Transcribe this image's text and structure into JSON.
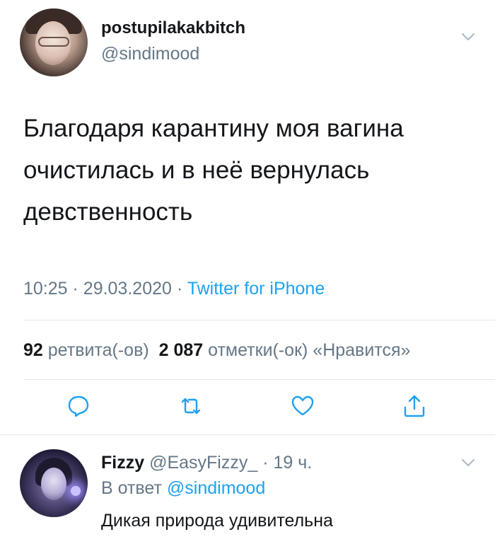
{
  "tweet": {
    "author_name": "postupilakakbitch",
    "author_handle": "@sindimood",
    "text": "Благодаря карантину моя вагина очистилась и в неё вернулась девственность",
    "time": "10:25",
    "date": "29.03.2020",
    "source": "Twitter for iPhone",
    "separator": "·",
    "retweets_count": "92",
    "retweets_label": "ретвита(-ов)",
    "likes_count": "2 087",
    "likes_label": "отметки(-ок) «Нравится»"
  },
  "actions": {
    "reply_icon": "reply-icon",
    "retweet_icon": "retweet-icon",
    "like_icon": "heart-icon",
    "share_icon": "share-icon"
  },
  "reply": {
    "author_name": "Fizzy",
    "author_handle": "@EasyFizzy_",
    "separator": "·",
    "time_ago": "19 ч.",
    "reply_to_label": "В ответ",
    "reply_to_handle": "@sindimood",
    "text": "Дикая природа удивительна"
  },
  "colors": {
    "text": "#14171a",
    "secondary": "#657786",
    "accent": "#1da1f2",
    "divider": "#e1e8ed"
  }
}
